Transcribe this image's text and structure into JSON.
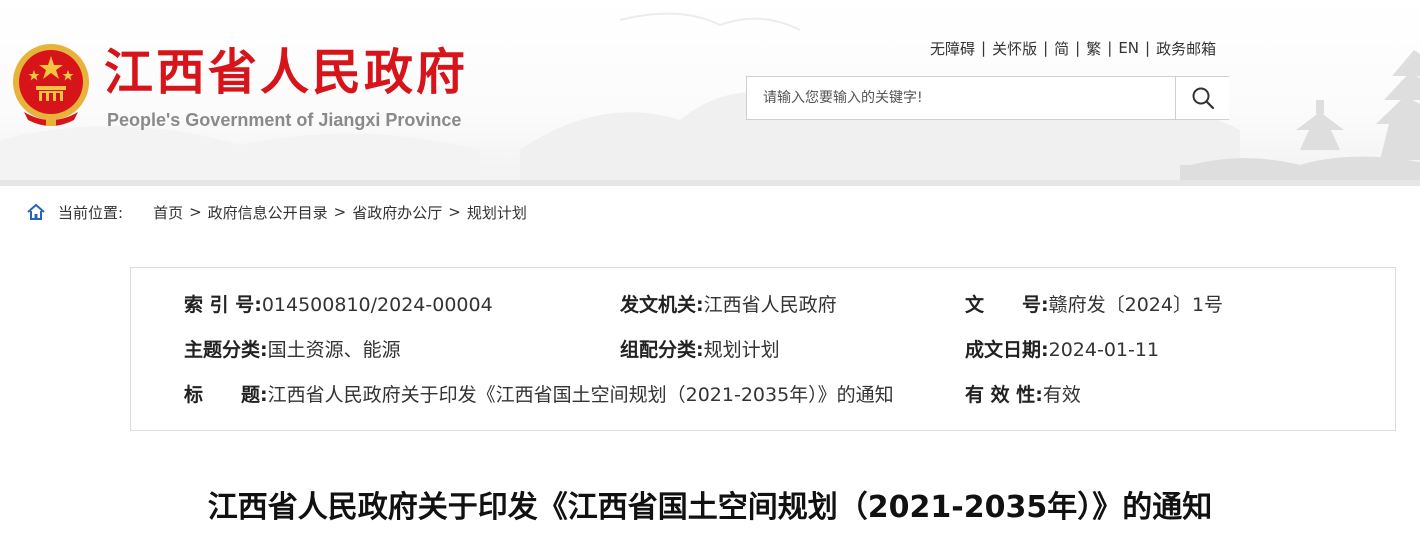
{
  "header": {
    "title": "江西省人民政府",
    "subtitle": "People's Government of Jiangxi Province",
    "links": [
      "无障碍",
      "关怀版",
      "简",
      "繁",
      "EN",
      "政务邮箱"
    ],
    "search": {
      "placeholder": "请输入您要输入的关键字!"
    },
    "icons": {
      "emblem": "national-emblem-icon",
      "search": "search-icon"
    },
    "colors": {
      "title": "#d7141a",
      "subtitle": "#8a8a8a"
    }
  },
  "breadcrumb": {
    "label": "当前位置:",
    "icon": "home-icon",
    "items": [
      "首页",
      "政府信息公开目录",
      "省政府办公厅",
      "规划计划"
    ],
    "separator": ">"
  },
  "meta": {
    "index_no": {
      "label": "索 引 号:",
      "value": "014500810/2024-00004"
    },
    "issuer": {
      "label": "发文机关:",
      "value": "江西省人民政府"
    },
    "doc_no": {
      "label": "文　　号:",
      "value": "赣府发〔2024〕1号"
    },
    "topic": {
      "label": "主题分类:",
      "value": "国土资源、能源"
    },
    "category": {
      "label": "组配分类:",
      "value": "规划计划"
    },
    "date": {
      "label": "成文日期:",
      "value": "2024-01-11"
    },
    "title": {
      "label": "标　　题:",
      "value": "江西省人民政府关于印发《江西省国土空间规划（2021-2035年）》的通知"
    },
    "validity": {
      "label": "有 效 性:",
      "value": "有效"
    }
  },
  "article": {
    "title": "江西省人民政府关于印发《江西省国土空间规划（2021-2035年）》的通知"
  }
}
